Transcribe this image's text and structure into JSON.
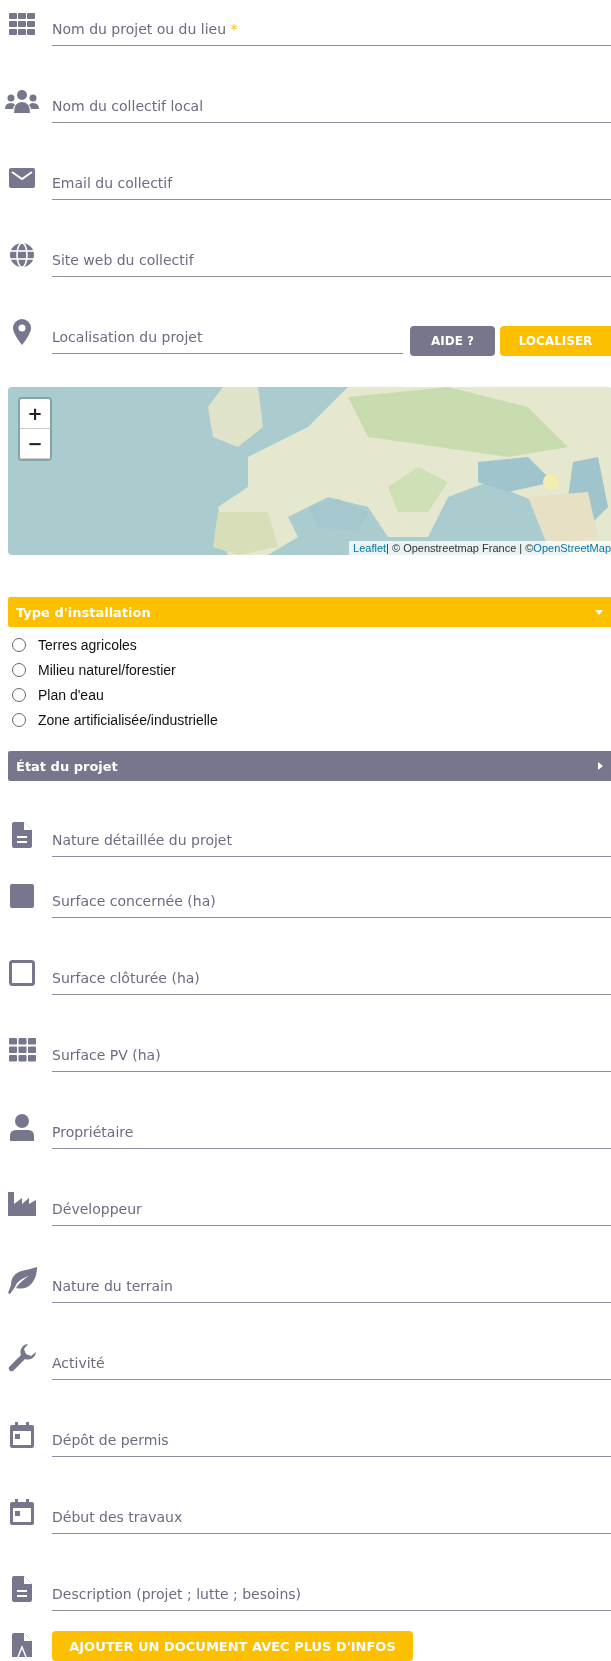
{
  "contact_fields": [
    {
      "placeholder": "Nom du projet ou du lieu",
      "required_mark": "*"
    },
    {
      "placeholder": "Nom du collectif local"
    },
    {
      "placeholder": "Email du collectif"
    },
    {
      "placeholder": "Site web du collectif"
    }
  ],
  "location": {
    "placeholder": "Localisation du projet",
    "buttons": [
      {
        "label": "AIDE ?",
        "kind": "secondary"
      },
      {
        "label": "LOCALISER",
        "kind": "primary"
      }
    ]
  },
  "map": {
    "kind": "picture",
    "zoom_in": "+",
    "zoom_out": "−",
    "attribution": [
      {
        "text": "Leaflet",
        "link": true
      },
      {
        "text": "| © Openstreetmap France | ©",
        "link": false
      },
      {
        "text": "OpenStreetMap",
        "link": true
      }
    ]
  },
  "sections": [
    {
      "title": "Type d'installation",
      "expanded": true,
      "options": [
        {
          "label": "Terres agricoles",
          "selected": false
        },
        {
          "label": "Milieu naturel/forestier",
          "selected": false
        },
        {
          "label": "Plan d'eau",
          "selected": false
        },
        {
          "label": "Zone artificialisée/industrielle",
          "selected": false
        }
      ]
    },
    {
      "title": "État du projet",
      "expanded": false
    }
  ],
  "project_fields": [
    {
      "placeholder": "Nature détaillée du projet"
    },
    {
      "placeholder": "Surface concernée (ha)"
    },
    {
      "placeholder": "Surface clôturée (ha)"
    },
    {
      "placeholder": "Surface PV (ha)"
    },
    {
      "placeholder": "Propriétaire"
    },
    {
      "placeholder": "Développeur"
    },
    {
      "placeholder": "Nature du terrain"
    },
    {
      "placeholder": "Activité"
    },
    {
      "placeholder": "Dépôt de permis"
    },
    {
      "placeholder": "Début des travaux"
    },
    {
      "placeholder": "Description (projet ; lutte ; besoins)"
    }
  ],
  "add_document_button": {
    "label": "AJOUTER UN DOCUMENT AVEC PLUS D'INFOS"
  }
}
